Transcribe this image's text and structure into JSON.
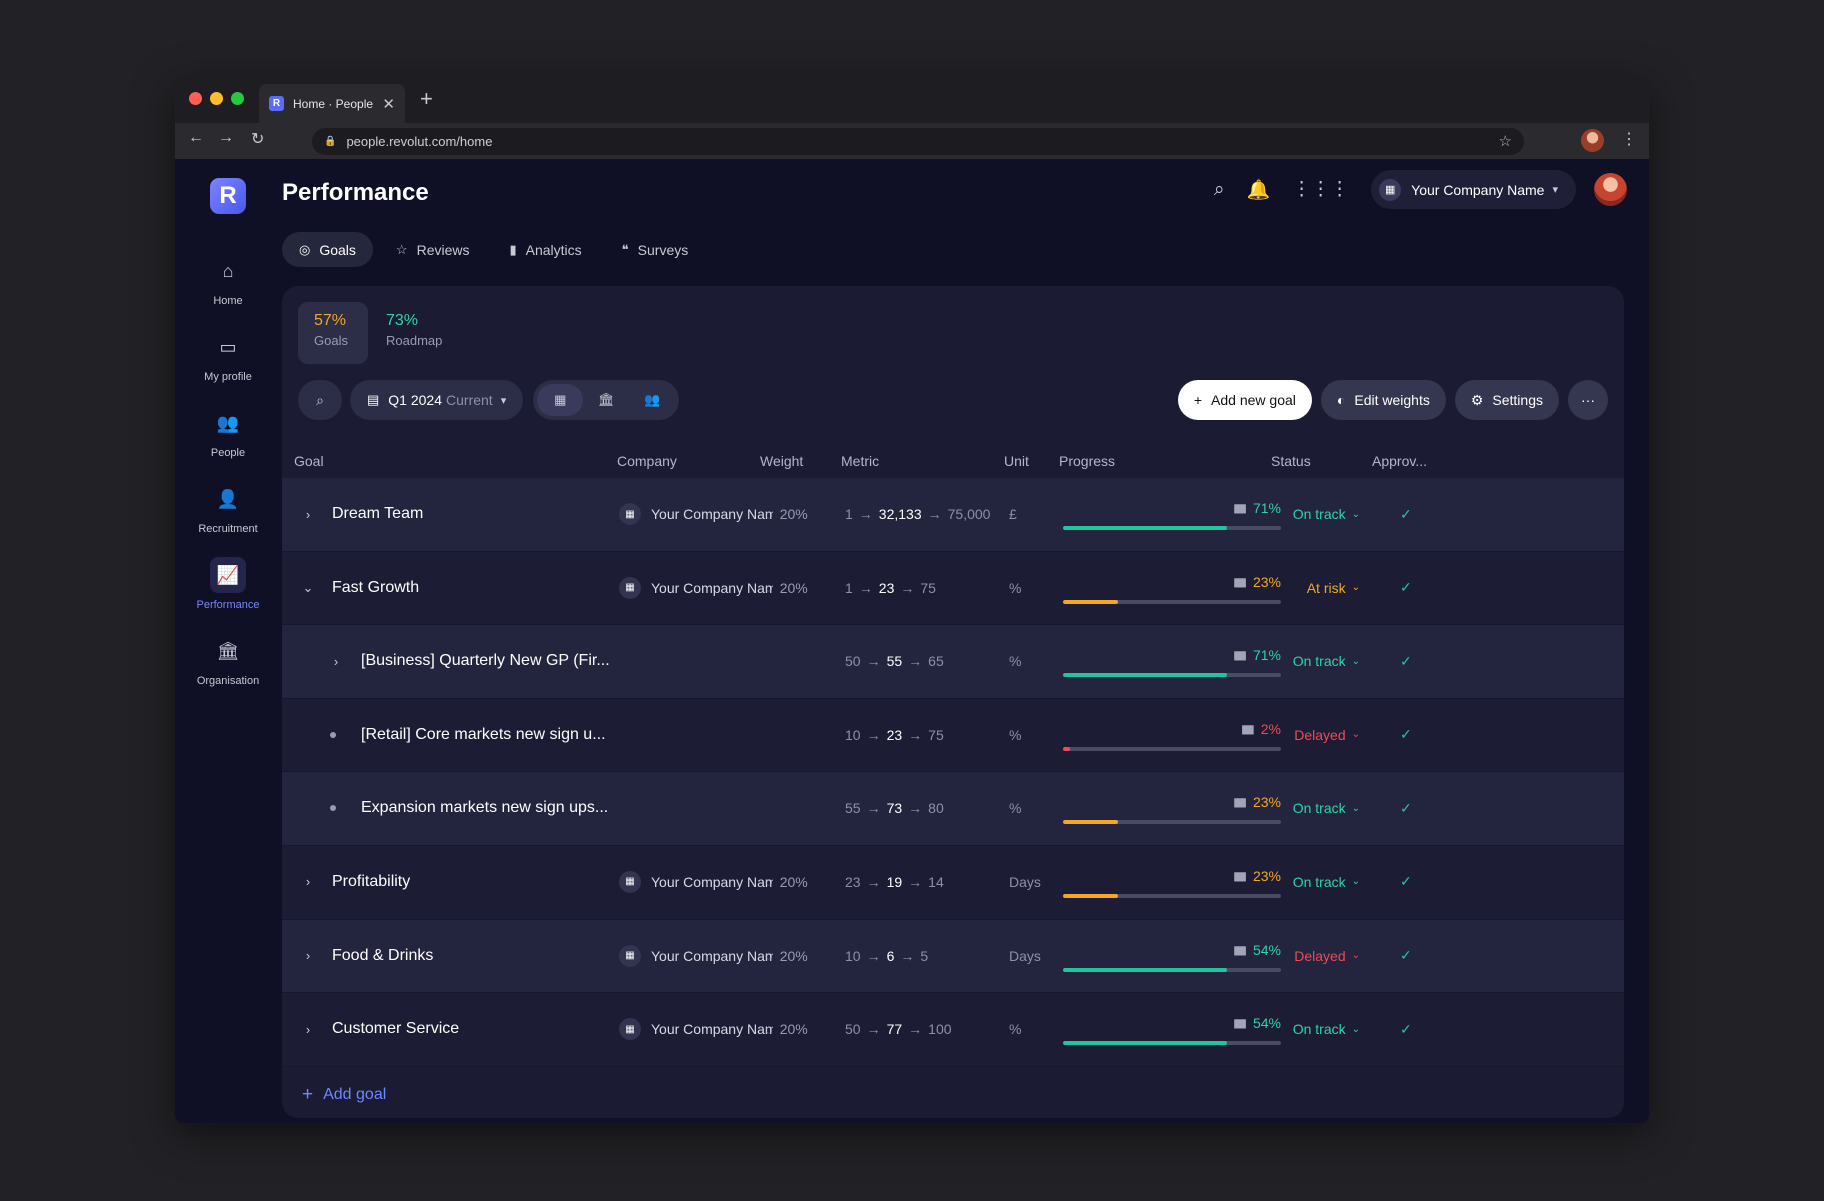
{
  "browser": {
    "tab_title": "Home · People",
    "favicon": "R",
    "url": "people.revolut.com/home",
    "new_tab": "+",
    "close": "✕"
  },
  "app": {
    "logo": "R",
    "page_title": "Performance",
    "company": "Your Company Name",
    "nav": [
      {
        "label": "Home",
        "icon": "home-icon",
        "glyph": "⌂"
      },
      {
        "label": "My profile",
        "icon": "id-card-icon",
        "glyph": "▭"
      },
      {
        "label": "People",
        "icon": "people-icon",
        "glyph": "👥"
      },
      {
        "label": "Recruitment",
        "icon": "recruitment-icon",
        "glyph": "👤"
      },
      {
        "label": "Performance",
        "icon": "performance-icon",
        "glyph": "📈"
      },
      {
        "label": "Organisation",
        "icon": "organisation-icon",
        "glyph": "🏛"
      }
    ],
    "tabs": [
      {
        "label": "Goals",
        "glyph": "◎"
      },
      {
        "label": "Reviews",
        "glyph": "☆"
      },
      {
        "label": "Analytics",
        "glyph": "▮"
      },
      {
        "label": "Surveys",
        "glyph": "❝"
      }
    ]
  },
  "kpis": [
    {
      "value": "57%",
      "label": "Goals",
      "color": "#f5a623"
    },
    {
      "value": "73%",
      "label": "Roadmap",
      "color": "#2ed3a8"
    }
  ],
  "filters": {
    "period": "Q1 2024",
    "period_tag": "Current"
  },
  "actions": {
    "add_goal": "Add new goal",
    "edit_weights": "Edit weights",
    "settings": "Settings",
    "more": "···"
  },
  "columns": {
    "goal": "Goal",
    "company": "Company",
    "weight": "Weight",
    "metric": "Metric",
    "unit": "Unit",
    "progress": "Progress",
    "status": "Status",
    "approval": "Approv..."
  },
  "rows": [
    {
      "name": "Dream Team",
      "level": 0,
      "expander": "›",
      "company": "Your Company Name",
      "weight": "20%",
      "initial": "1",
      "current": "32,133",
      "target": "75,000",
      "unit": "£",
      "progress_label": "71%",
      "progress": 0.75,
      "bar_color": "#22c59e",
      "pct_color": "#2ed3a8",
      "status": "On track",
      "status_color": "#2ed3a8"
    },
    {
      "name": "Fast Growth",
      "level": 0,
      "expander": "⌄",
      "company": "Your Company Name",
      "weight": "20%",
      "initial": "1",
      "current": "23",
      "target": "75",
      "unit": "%",
      "progress_label": "23%",
      "progress": 0.25,
      "bar_color": "#f5a623",
      "pct_color": "#f5a623",
      "status": "At risk",
      "status_color": "#f5a623"
    },
    {
      "name": "[Business] Quarterly New GP (Fir...",
      "level": 1,
      "expander": "›",
      "company": "",
      "weight": "",
      "initial": "50",
      "current": "55",
      "target": "65",
      "unit": "%",
      "progress_label": "71%",
      "progress": 0.75,
      "bar_color": "#22c59e",
      "pct_color": "#2ed3a8",
      "status": "On track",
      "status_color": "#2ed3a8"
    },
    {
      "name": "[Retail] Core markets new sign u...",
      "level": 1,
      "expander": "•",
      "company": "",
      "weight": "",
      "initial": "10",
      "current": "23",
      "target": "75",
      "unit": "%",
      "progress_label": "2%",
      "progress": 0.03,
      "bar_color": "#ef4b55",
      "pct_color": "#ef4b55",
      "status": "Delayed",
      "status_color": "#ef4b55"
    },
    {
      "name": "Expansion markets new sign ups...",
      "level": 1,
      "expander": "•",
      "company": "",
      "weight": "",
      "initial": "55",
      "current": "73",
      "target": "80",
      "unit": "%",
      "progress_label": "23%",
      "progress": 0.25,
      "bar_color": "#f5a623",
      "pct_color": "#f5a623",
      "status": "On track",
      "status_color": "#2ed3a8"
    },
    {
      "name": "Profitability",
      "level": 0,
      "expander": "›",
      "company": "Your Company Name",
      "weight": "20%",
      "initial": "23",
      "current": "19",
      "target": "14",
      "unit": "Days",
      "progress_label": "23%",
      "progress": 0.25,
      "bar_color": "#f5a623",
      "pct_color": "#f5a623",
      "status": "On track",
      "status_color": "#2ed3a8"
    },
    {
      "name": "Food & Drinks",
      "level": 0,
      "expander": "›",
      "company": "Your Company Name",
      "weight": "20%",
      "initial": "10",
      "current": "6",
      "target": "5",
      "unit": "Days",
      "progress_label": "54%",
      "progress": 0.75,
      "bar_color": "#22c59e",
      "pct_color": "#2ed3a8",
      "status": "Delayed",
      "status_color": "#ef4b55"
    },
    {
      "name": "Customer Service",
      "level": 0,
      "expander": "›",
      "company": "Your Company Name",
      "weight": "20%",
      "initial": "50",
      "current": "77",
      "target": "100",
      "unit": "%",
      "progress_label": "54%",
      "progress": 0.75,
      "bar_color": "#22c59e",
      "pct_color": "#2ed3a8",
      "status": "On track",
      "status_color": "#2ed3a8"
    }
  ],
  "footer": {
    "add_goal": "Add goal"
  }
}
